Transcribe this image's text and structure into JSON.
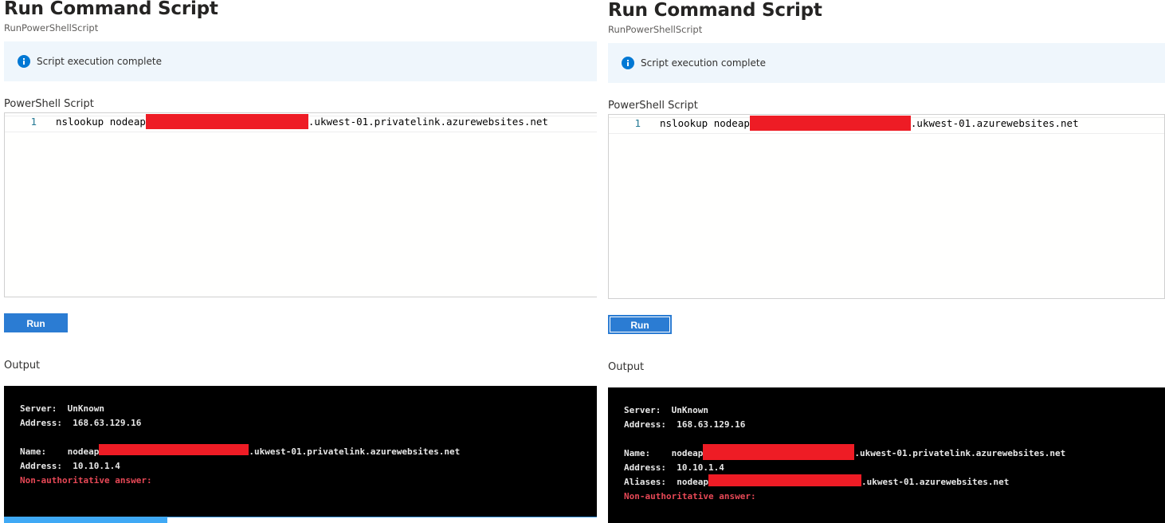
{
  "left": {
    "title": "Run Command Script",
    "subtitle": "RunPowerShellScript",
    "info_message": "Script execution complete",
    "script_label": "PowerShell Script",
    "line_number": "1",
    "code_prefix": "nslookup nodeap",
    "code_suffix": ".ukwest-01.privatelink.azurewebsites.net",
    "run_label": "Run",
    "output_label": "Output",
    "output": {
      "server_key": "Server:",
      "server_value": "UnKnown",
      "address_key": "Address:",
      "address_value": "168.63.129.16",
      "name_key": "Name:",
      "name_prefix": "nodeap",
      "name_suffix": ".ukwest-01.privatelink.azurewebsites.net",
      "name_address_key": "Address:",
      "name_address_value": "10.10.1.4",
      "warning": "Non-authoritative answer:"
    }
  },
  "right": {
    "title": "Run Command Script",
    "subtitle": "RunPowerShellScript",
    "info_message": "Script execution complete",
    "script_label": "PowerShell Script",
    "line_number": "1",
    "code_prefix": "nslookup nodeap",
    "code_suffix": ".ukwest-01.azurewebsites.net",
    "run_label": "Run",
    "output_label": "Output",
    "output": {
      "server_key": "Server:",
      "server_value": "UnKnown",
      "address_key": "Address:",
      "address_value": "168.63.129.16",
      "name_key": "Name:",
      "name_prefix": "nodeap",
      "name_suffix": ".ukwest-01.privatelink.azurewebsites.net",
      "name_address_key": "Address:",
      "name_address_value": "10.10.1.4",
      "aliases_key": "Aliases:",
      "aliases_prefix": "nodeap",
      "aliases_suffix": ".ukwest-01.azurewebsites.net",
      "warning": "Non-authoritative answer:"
    }
  },
  "colors": {
    "accent": "#2b7cd3",
    "info_background": "#eff6fc",
    "redaction": "#ee1c25",
    "console_background": "#000000",
    "warning_text": "#e74856"
  },
  "icons": {
    "info": "info-icon"
  }
}
